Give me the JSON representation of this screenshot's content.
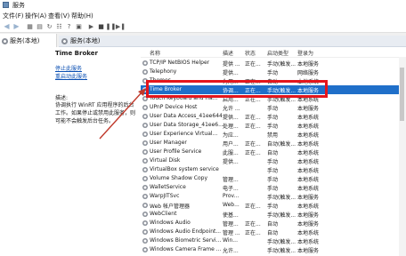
{
  "window": {
    "title": "服务"
  },
  "menu": [
    "文件(F)",
    "操作(A)",
    "查看(V)",
    "帮助(H)"
  ],
  "tree": {
    "root": "服务(本地)"
  },
  "panel": {
    "header": "服务(本地)"
  },
  "selected": {
    "name": "Time Broker",
    "stop_link": "停止此服务",
    "restart_link": "重启动此服务",
    "desc_label": "描述:",
    "desc_text": "协调执行 WinRT 应用程序的后台工作。如果停止或禁用此服务，则可能不会触发后台任务。"
  },
  "columns": {
    "name": "名称",
    "desc": "描述",
    "status": "状态",
    "startup": "启动类型",
    "logon": "登录为"
  },
  "rows": [
    {
      "name": "TCP/IP NetBIOS Helper",
      "desc": "提供 ...",
      "status": "正在...",
      "startup": "手动(触发...",
      "logon": "本地服务"
    },
    {
      "name": "Telephony",
      "desc": "提供...",
      "status": "",
      "startup": "手动",
      "logon": "网络服务"
    },
    {
      "name": "Themes",
      "desc": "为用...",
      "status": "正在...",
      "startup": "自动",
      "logon": "本地系统"
    },
    {
      "name": "Time Broker",
      "desc": "协调...",
      "status": "正在...",
      "startup": "手动(触发...",
      "logon": "本地服务"
    },
    {
      "name": "Touch Keyboard and Ha...",
      "desc": "启用...",
      "status": "正在...",
      "startup": "手动(触发...",
      "logon": "本地系统"
    },
    {
      "name": "UPnP Device Host",
      "desc": "允许 ...",
      "status": "",
      "startup": "手动",
      "logon": "本地服务"
    },
    {
      "name": "User Data Access_41ee644",
      "desc": "提供...",
      "status": "正在...",
      "startup": "手动",
      "logon": "本地系统"
    },
    {
      "name": "User Data Storage_41ee6...",
      "desc": "处理...",
      "status": "正在...",
      "startup": "手动",
      "logon": "本地系统"
    },
    {
      "name": "User Experience Virtual...",
      "desc": "为应...",
      "status": "",
      "startup": "禁用",
      "logon": "本地系统"
    },
    {
      "name": "User Manager",
      "desc": "用户...",
      "status": "正在...",
      "startup": "自动(触发...",
      "logon": "本地系统"
    },
    {
      "name": "User Profile Service",
      "desc": "此服...",
      "status": "正在...",
      "startup": "自动",
      "logon": "本地系统"
    },
    {
      "name": "Virtual Disk",
      "desc": "提供...",
      "status": "",
      "startup": "手动",
      "logon": "本地系统"
    },
    {
      "name": "VirtualBox system service",
      "desc": "",
      "status": "",
      "startup": "手动",
      "logon": "本地系统"
    },
    {
      "name": "Volume Shadow Copy",
      "desc": "管理...",
      "status": "",
      "startup": "手动",
      "logon": "本地系统"
    },
    {
      "name": "WalletService",
      "desc": "电子...",
      "status": "",
      "startup": "手动",
      "logon": "本地系统"
    },
    {
      "name": "WarpJITSvc",
      "desc": "Prov...",
      "status": "",
      "startup": "手动(触发...",
      "logon": "本地服务"
    },
    {
      "name": "Web 帐户管理器",
      "desc": "Web...",
      "status": "正在...",
      "startup": "手动",
      "logon": "本地系统"
    },
    {
      "name": "WebClient",
      "desc": "使基...",
      "status": "",
      "startup": "手动(触发...",
      "logon": "本地服务"
    },
    {
      "name": "Windows Audio",
      "desc": "管理...",
      "status": "正在...",
      "startup": "自动",
      "logon": "本地服务"
    },
    {
      "name": "Windows Audio Endpoint...",
      "desc": "管理 ...",
      "status": "正在...",
      "startup": "自动",
      "logon": "本地系统"
    },
    {
      "name": "Windows Biometric Servi...",
      "desc": "Win...",
      "status": "",
      "startup": "手动(触发...",
      "logon": "本地系统"
    },
    {
      "name": "Windows Camera Frame ...",
      "desc": "允许...",
      "status": "",
      "startup": "手动(触发...",
      "logon": "本地服务"
    }
  ],
  "colors": {
    "selection": "#1f6fc9",
    "highlight_box": "#e4151c",
    "arrow": "#c0392b"
  }
}
